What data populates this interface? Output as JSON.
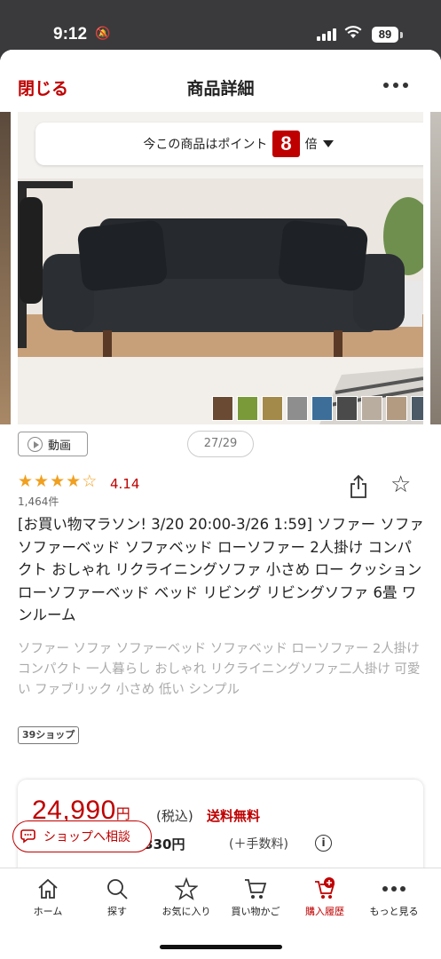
{
  "status_bar": {
    "time": "9:12",
    "battery": "89"
  },
  "header": {
    "close_label": "閉じる",
    "title": "商品詳細"
  },
  "points_banner": {
    "prefix": "今この商品はポイント",
    "points": "8",
    "suffix": "倍"
  },
  "gallery": {
    "page_counter": "27/29",
    "video_label": "動画",
    "swatch_colors": [
      "#6b4a33",
      "#7a9a3a",
      "#a38a4a",
      "#8e8e8e",
      "#3d6e9a",
      "#4a4a4a",
      "#b9ada0",
      "#b39b82",
      "#4b5a66"
    ]
  },
  "rating": {
    "value": "4.14",
    "count": "1,464件",
    "stars_filled": 4,
    "stars_total": 5
  },
  "product": {
    "title": "[お買い物マラソン! 3/20 20:00-3/26 1:59] ソファー ソファ ソファーベッド ソファベッド ローソファー 2人掛け コンパクト おしゃれ リクライニングソファ 小さめ ロー クッション ローソファーベッド ベッド リビング リビングソファ 6畳 ワンルーム",
    "subtitle": "ソファー ソファ ソファーベッド ソファベッド ローソファー 2人掛け コンパクト 一人暮らし おしゃれ リクライニングソファ二人掛け 可愛い ファブリック 小さめ 低い シンプル",
    "shop_badge": "39ショップ"
  },
  "price": {
    "amount": "24,990",
    "yen": "円",
    "tax": "(税込)",
    "shipping": "送料無料",
    "installment": "8,330円",
    "installment_note": "(＋手数料)"
  },
  "consult_button": "ショップへ相談",
  "tabbar": [
    {
      "label": "ホーム",
      "icon": "home-icon"
    },
    {
      "label": "探す",
      "icon": "search-icon"
    },
    {
      "label": "お気に入り",
      "icon": "star-icon"
    },
    {
      "label": "買い物かご",
      "icon": "cart-icon"
    },
    {
      "label": "購入履歴",
      "icon": "history-icon"
    },
    {
      "label": "もっと見る",
      "icon": "more-icon"
    }
  ],
  "colors": {
    "brand_red": "#bf0000",
    "star": "#f0a020"
  }
}
